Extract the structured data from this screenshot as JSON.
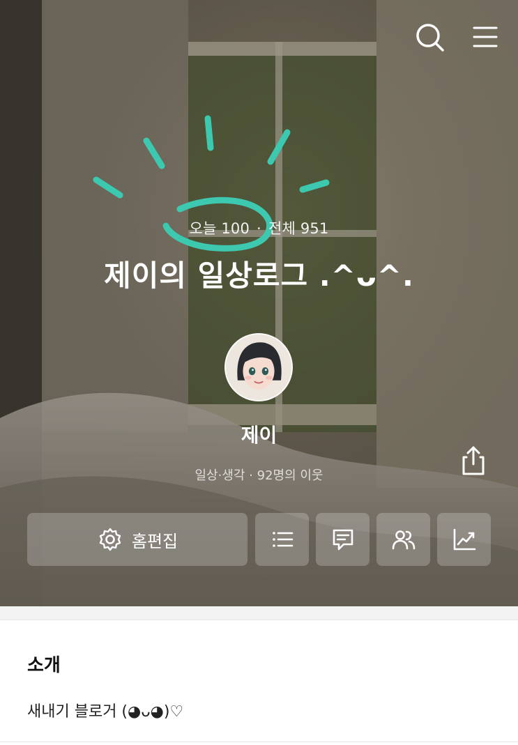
{
  "header": {
    "search_icon": "search-icon",
    "menu_icon": "hamburger-menu-icon"
  },
  "blog": {
    "stats_today": "오늘 100",
    "stats_separator": "·",
    "stats_total": "전체 951",
    "title": "제이의 일상로그 .^ᴗ^.",
    "nickname": "제이",
    "meta": "일상·생각 · 92명의 이웃"
  },
  "actions": {
    "edit_label": "홈편집",
    "edit_icon": "gear-icon",
    "list_icon": "list-icon",
    "comment_icon": "comment-icon",
    "neighbors_icon": "people-icon",
    "stats_icon": "chart-icon",
    "share_icon": "share-icon"
  },
  "intro": {
    "heading": "소개",
    "text": "새내기 블로거 (◕ᴗ◕)♡"
  },
  "colors": {
    "doodle": "#3cc9b0",
    "button_bg": "rgba(255,255,255,0.22)",
    "text_white": "#ffffff"
  }
}
